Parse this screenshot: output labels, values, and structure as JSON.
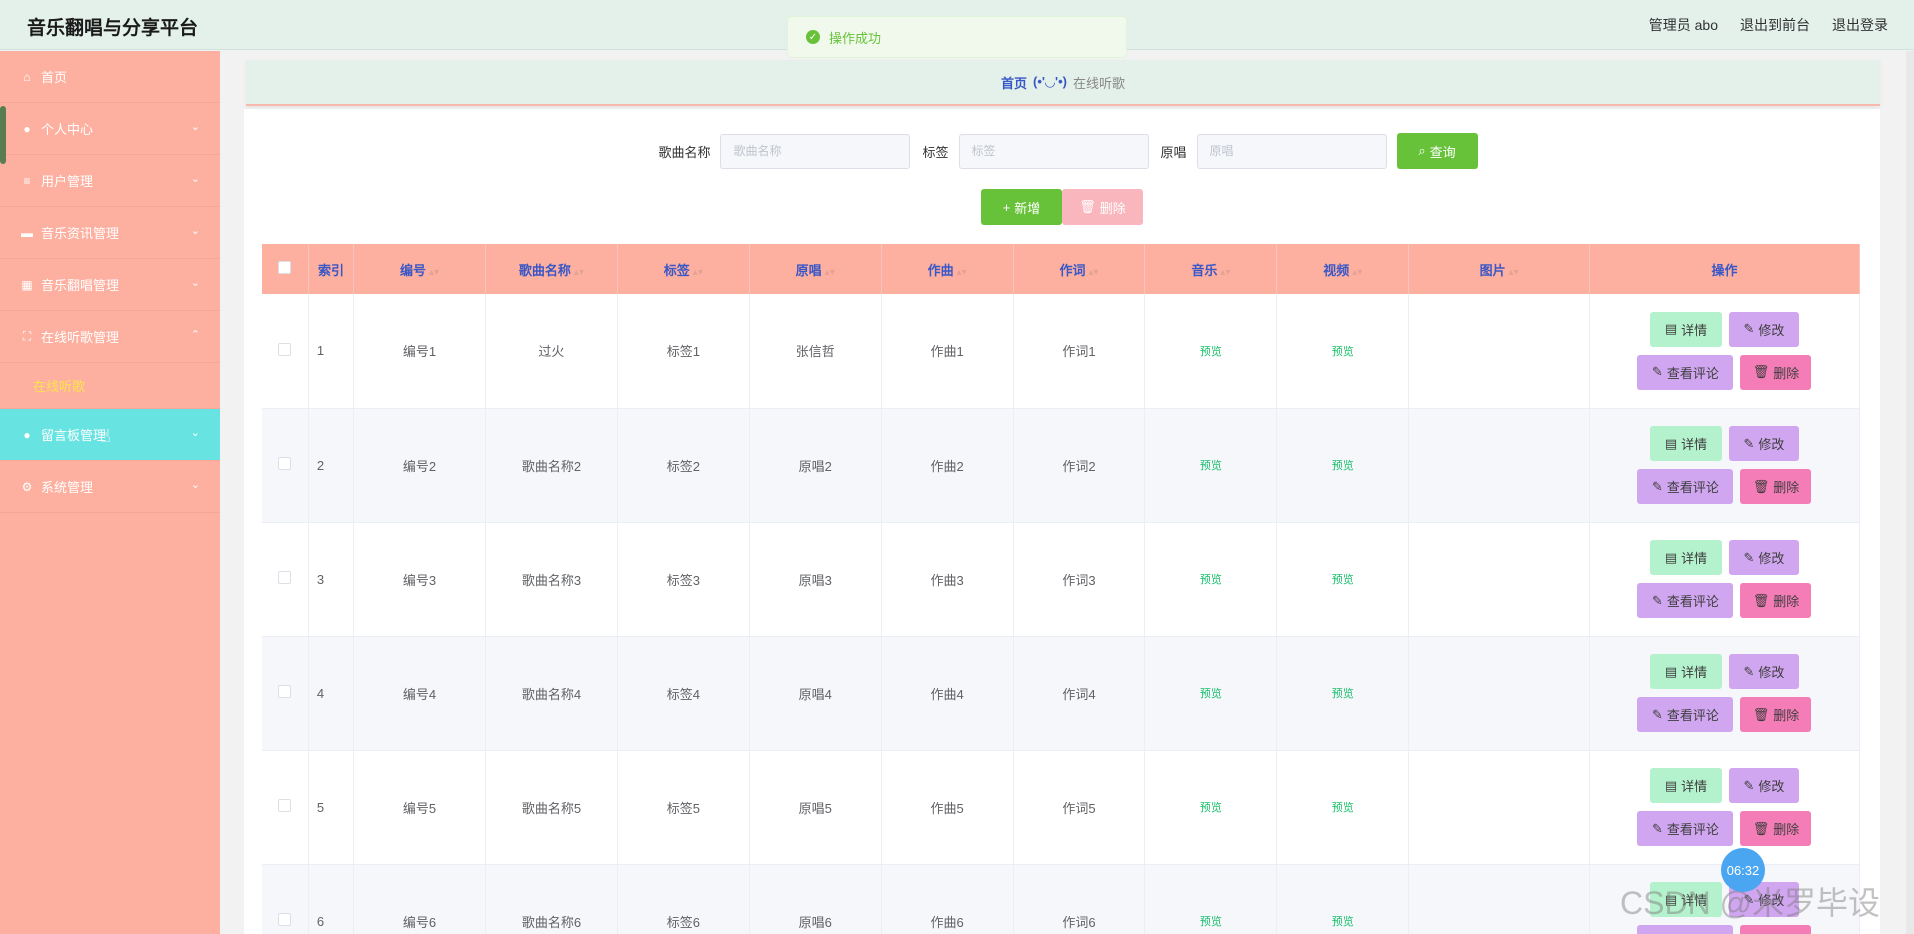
{
  "app": {
    "title": "音乐翻唱与分享平台"
  },
  "topbar": {
    "user": "管理员 abo",
    "front": "退出到前台",
    "logout": "退出登录"
  },
  "toast": {
    "text": "操作成功"
  },
  "sidebar": {
    "items": [
      {
        "label": "首页",
        "icon": "home-icon",
        "glyph": "⌂"
      },
      {
        "label": "个人中心",
        "icon": "user-icon",
        "glyph": "●",
        "chevron": "⌄"
      },
      {
        "label": "用户管理",
        "icon": "list-icon",
        "glyph": "≡",
        "chevron": "⌄"
      },
      {
        "label": "音乐资讯管理",
        "icon": "ticket-icon",
        "glyph": "▬",
        "chevron": "⌄"
      },
      {
        "label": "音乐翻唱管理",
        "icon": "grid-icon",
        "glyph": "▦",
        "chevron": "⌄"
      },
      {
        "label": "在线听歌管理",
        "icon": "fullscreen-icon",
        "glyph": "⛶",
        "chevron": "⌃"
      },
      {
        "label": "留言板管理",
        "icon": "user-icon",
        "glyph": "●",
        "chevron": "⌄"
      },
      {
        "label": "系统管理",
        "icon": "settings-icon",
        "glyph": "⚙",
        "chevron": "⌄"
      }
    ],
    "subitem": "在线听歌"
  },
  "breadcrumb": {
    "home": "首页",
    "face": "(•'◡'•)",
    "current": "在线听歌"
  },
  "search": {
    "song_label": "歌曲名称",
    "song_placeholder": "歌曲名称",
    "tag_label": "标签",
    "tag_placeholder": "标签",
    "singer_label": "原唱",
    "singer_placeholder": "原唱",
    "query": "查询"
  },
  "buttons": {
    "add": "新增",
    "delete": "删除"
  },
  "table": {
    "headers": [
      "索引",
      "编号",
      "歌曲名称",
      "标签",
      "原唱",
      "作曲",
      "作词",
      "音乐",
      "视频",
      "图片",
      "操作"
    ],
    "rows": [
      {
        "index": "1",
        "code": "编号1",
        "name": "过火",
        "tag": "标签1",
        "singer": "张信哲",
        "composer": "作曲1",
        "lyricist": "作词1",
        "music": "预览",
        "video": "预览"
      },
      {
        "index": "2",
        "code": "编号2",
        "name": "歌曲名称2",
        "tag": "标签2",
        "singer": "原唱2",
        "composer": "作曲2",
        "lyricist": "作词2",
        "music": "预览",
        "video": "预览"
      },
      {
        "index": "3",
        "code": "编号3",
        "name": "歌曲名称3",
        "tag": "标签3",
        "singer": "原唱3",
        "composer": "作曲3",
        "lyricist": "作词3",
        "music": "预览",
        "video": "预览"
      },
      {
        "index": "4",
        "code": "编号4",
        "name": "歌曲名称4",
        "tag": "标签4",
        "singer": "原唱4",
        "composer": "作曲4",
        "lyricist": "作词4",
        "music": "预览",
        "video": "预览"
      },
      {
        "index": "5",
        "code": "编号5",
        "name": "歌曲名称5",
        "tag": "标签5",
        "singer": "原唱5",
        "composer": "作曲5",
        "lyricist": "作词5",
        "music": "预览",
        "video": "预览"
      },
      {
        "index": "6",
        "code": "编号6",
        "name": "歌曲名称6",
        "tag": "标签6",
        "singer": "原唱6",
        "composer": "作曲6",
        "lyricist": "作词6",
        "music": "预览",
        "video": "预览"
      }
    ],
    "ops": {
      "detail": "详情",
      "edit": "修改",
      "comment": "查看评论",
      "delete": "删除"
    }
  },
  "clock": "06:32",
  "watermark": "CSDN @米罗毕设"
}
